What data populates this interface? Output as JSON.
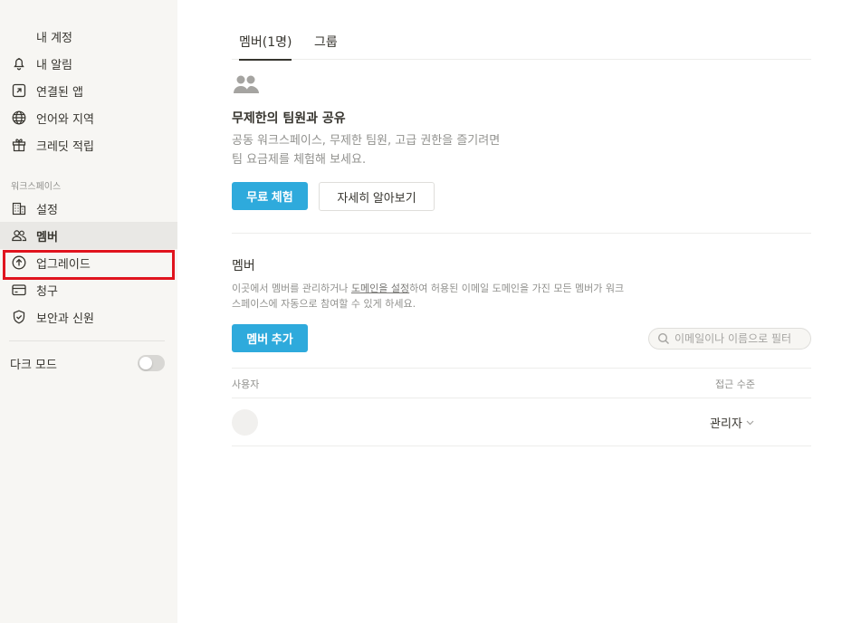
{
  "sidebar": {
    "account_items": [
      {
        "label": "내 계정"
      },
      {
        "label": "내 알림"
      },
      {
        "label": "연결된 앱"
      },
      {
        "label": "언어와 지역"
      },
      {
        "label": "크레딧 적립"
      }
    ],
    "workspace_label": "워크스페이스",
    "workspace_items": [
      {
        "label": "설정"
      },
      {
        "label": "멤버"
      },
      {
        "label": "업그레이드"
      },
      {
        "label": "청구"
      },
      {
        "label": "보안과 신원"
      }
    ],
    "dark_mode_label": "다크 모드",
    "dark_mode_on": false
  },
  "tabs": [
    {
      "label": "멤버(1명)"
    },
    {
      "label": "그룹"
    }
  ],
  "promo": {
    "title": "무제한의 팀원과 공유",
    "desc_line1": "공동 워크스페이스, 무제한 팀원, 고급 권한을 즐기려면",
    "desc_line2": "팀 요금제를 체험해 보세요.",
    "trial_button": "무료 체험",
    "learn_more_button": "자세히 알아보기"
  },
  "members": {
    "heading": "멤버",
    "desc_part1": "이곳에서 멤버를 관리하거나 ",
    "desc_link": "도메인을 설정",
    "desc_part2": "하여 허용된 이메일 도메인을 가진 모든 멤버가 워크",
    "desc_line2": "스페이스에 자동으로 참여할 수 있게 하세요.",
    "add_button": "멤버 추가",
    "search_placeholder": "이메일이나 이름으로 필터",
    "col_user": "사용자",
    "col_access": "접근 수준",
    "rows": [
      {
        "role": "관리자"
      }
    ]
  },
  "colors": {
    "accent": "#2eaadc",
    "sidebar_bg": "#f7f6f3",
    "highlight": "#e0141e"
  }
}
